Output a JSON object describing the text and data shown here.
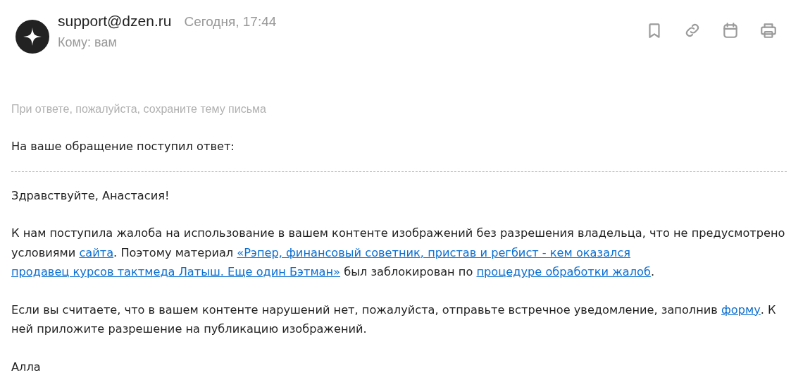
{
  "sender": {
    "email": "support@dzen.ru",
    "date": "Сегодня, 17:44",
    "to": "Кому: вам"
  },
  "hint": "При ответе, пожалуйста, сохраните тему письма",
  "intro": "На ваше обращение поступил ответ:",
  "greeting": "Здравствуйте, Анастасия!",
  "paragraphs": [
    [
      {
        "text": "К нам поступила жалоба на использование в вашем контенте изображений без разрешения владельца, что не предусмотрено условиями ",
        "link": false
      },
      {
        "text": "сайта",
        "link": true
      },
      {
        "text": ". Поэтому материал ",
        "link": false
      },
      {
        "text": "«Рэпер, финансовый советник, пристав и регбист - кем оказался",
        "link": true
      },
      {
        "text": "продавец курсов тактмеда Латыш. Еще один Бэтман»",
        "link": true
      },
      {
        "text": " был заблокирован по ",
        "link": false
      },
      {
        "text": "процедуре обработки жалоб",
        "link": true
      },
      {
        "text": ".",
        "link": false
      }
    ],
    [
      {
        "text": "Если вы считаете, что в вашем контенте нарушений нет, пожалуйста, отправьте встречное уведомление, заполнив ",
        "link": false
      },
      {
        "text": "форму",
        "link": true
      },
      {
        "text": ". К ней приложите разрешение на публикацию изображений.",
        "link": false
      }
    ]
  ],
  "signature": "Алла"
}
